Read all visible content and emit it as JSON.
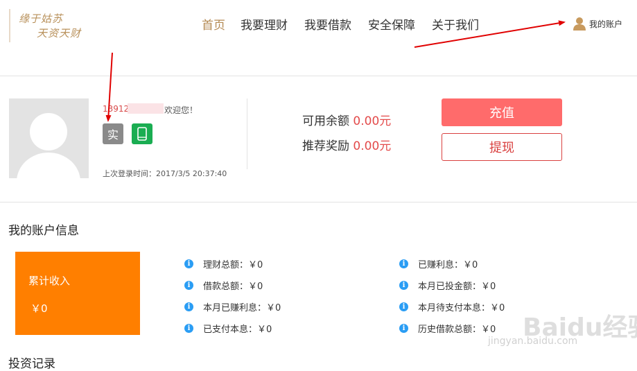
{
  "header": {
    "logo_line1": "缘于姑苏",
    "logo_line2": "天资天财",
    "nav": [
      "首页",
      "我要理财",
      "我要借款",
      "安全保障",
      "关于我们"
    ],
    "account_link": "我的账户"
  },
  "profile": {
    "phone_prefix": "13912",
    "welcome": "欢迎您！",
    "badge_realname": "实",
    "last_login": "上次登录时间：2017/3/5 20:37:40"
  },
  "balance": {
    "available_label": "可用余额",
    "available_value": "0.00元",
    "referral_label": "推荐奖励",
    "referral_value": "0.00元"
  },
  "actions": {
    "recharge": "充值",
    "withdraw": "提现"
  },
  "account_info": {
    "title": "我的账户信息",
    "card_label": "累计收入",
    "card_value": "￥0",
    "left_items": [
      "理财总额：￥0",
      "借款总额：￥0",
      "本月已赚利息：￥0",
      "已支付本息：￥0"
    ],
    "right_items": [
      "已赚利息：￥0",
      "本月已投金额：￥0",
      "本月待支付本息：￥0",
      "历史借款总额：￥0"
    ]
  },
  "next_section_title": "投资记录",
  "watermark": {
    "main": "Baidu经验",
    "sub": "jingyan.baidu.com"
  },
  "colors": {
    "accent_gold": "#b48a53",
    "recharge_bg": "#ff6b6b",
    "money_red": "#e34a4a",
    "income_orange": "#ff7f00",
    "info_blue": "#2a9df4",
    "realname_badge": "#8a8a8a",
    "mobile_badge": "#1aad52",
    "arrow_red": "#e00000"
  }
}
